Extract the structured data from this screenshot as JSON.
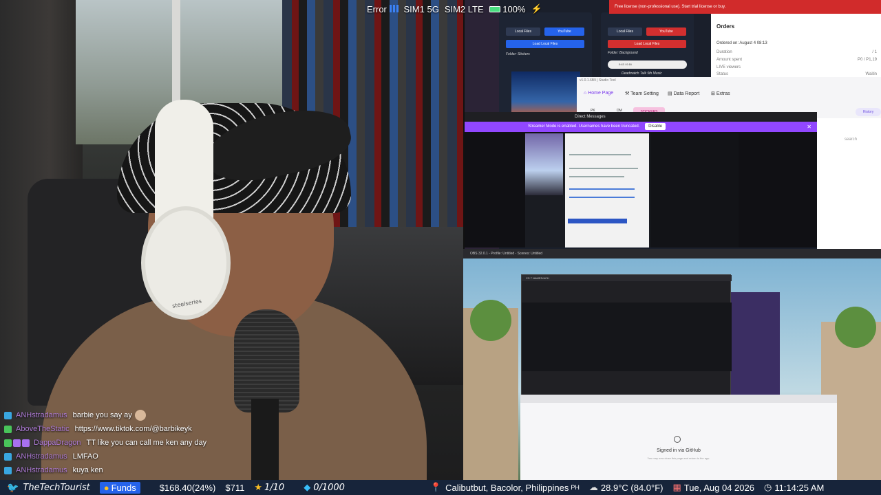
{
  "status_top": {
    "error": "Error",
    "sim1": "SIM1 5G",
    "sim2": "SIM2 LTE",
    "battery": "100%"
  },
  "webcam": {
    "headphone_brand": "steelseries"
  },
  "chat": [
    {
      "user": "ANHstradamus",
      "message": "barbie you say ay"
    },
    {
      "user": "AboveTheStatic",
      "message": "https://www.tiktok.com/@barbikeyk"
    },
    {
      "user": "DappaDragon",
      "message": "TT like you can call me ken any day"
    },
    {
      "user": "ANHstradamus",
      "message": "LMFAO"
    },
    {
      "user": "ANHstradamus",
      "message": "kuya ken"
    }
  ],
  "screen_top": {
    "left_panel": {
      "btn_local": "Local Files",
      "btn_youtube": "YouTube",
      "btn_load": "Load Local Files",
      "folder_label": "Folder: Stickers"
    },
    "right_panel": {
      "btn_local": "Local Files",
      "btn_youtube": "YouTube",
      "btn_load": "Load Local Files",
      "folder_label": "Folder: Background",
      "player_time": "0:43 / 0:16",
      "track": "Deadmatch Talk 5th Music"
    },
    "trial_banner": "Free license (non-professional use). Start trial license or buy.",
    "orders": {
      "title": "Orders",
      "ordered_on": "Ordered on: August 4 08:13",
      "rows": [
        {
          "label": "Duration",
          "value": "/ 1"
        },
        {
          "label": "Amount spent",
          "value": "P0 / P1,19"
        },
        {
          "label": "LIVE viewers",
          "value": ""
        },
        {
          "label": "Status",
          "value": "Waitin"
        }
      ]
    },
    "ttk": {
      "window_title": "v1.0.1.6B9 | Studio Tool",
      "nav_home": "Home Page",
      "nav_team": "Team Setting",
      "nav_report": "Data Report",
      "nav_extras": "Extras",
      "stickers": "STICKERS",
      "history": "History",
      "pk": "PK",
      "dm": "DM"
    },
    "dm_window": {
      "title": "Direct Messages",
      "banner": "Streamer Mode is enabled. Usernames have been truncated.",
      "disable": "Disable",
      "highlight_text": "good morning can u hear me???"
    },
    "search": "search"
  },
  "screen_bottom": {
    "title": "OBS 32.0.1 - Profile: Untitled - Scenes: Untitled",
    "obs_title": "CS 7 NAMES/ACH",
    "github_signed": "Signed in via GitHub",
    "github_sub": "You may now close this page and return to the app."
  },
  "ticker": {
    "channel": "TheTechTourist",
    "funds": "Funds",
    "money": "$168.40(24%)",
    "goal_money": "$711",
    "stars": "1/10",
    "gems": "0/1000",
    "location": "Calibutbut, Bacolor, Philippines",
    "country": "PH",
    "weather": "28.9°C (84.0°F)",
    "date": "Tue, Aug 04 2026",
    "time": "11:14:25 AM"
  },
  "colors": {
    "ticker_bg": "#17243a",
    "chat_user": "#b07cd9",
    "twitch_purple": "#9147ff",
    "trial_red": "#d12b2b"
  }
}
